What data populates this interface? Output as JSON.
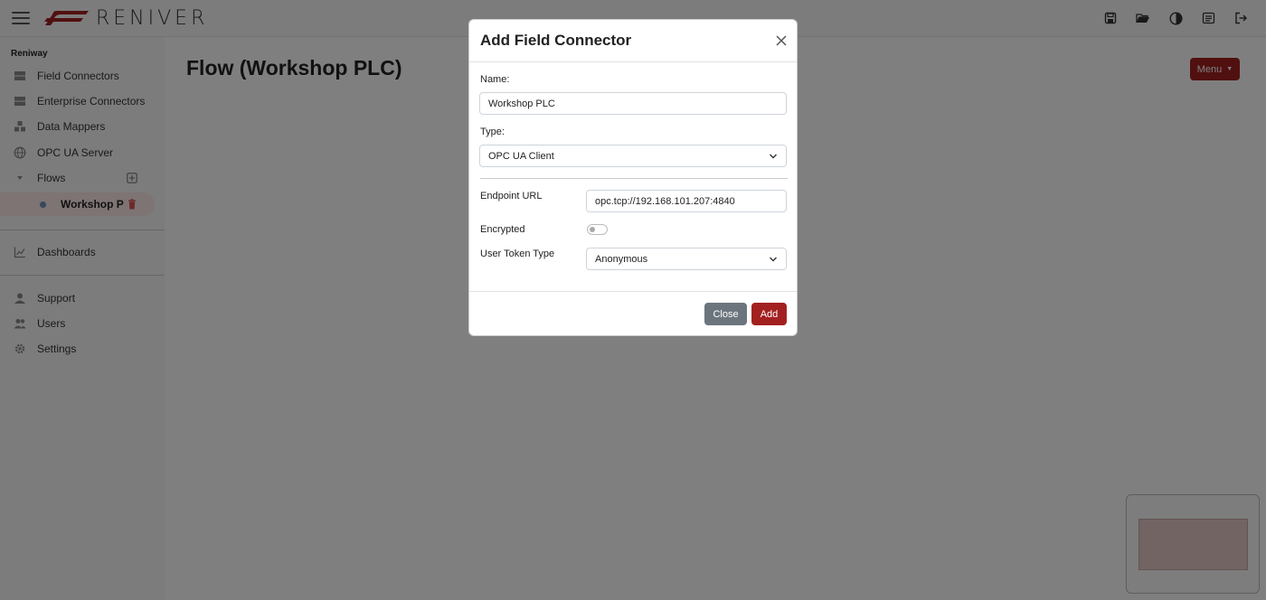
{
  "header": {
    "logo_text": "RENIVER",
    "icons": [
      "menu-icon",
      "save-icon",
      "folder-open-icon",
      "contrast-icon",
      "notes-icon",
      "logout-icon"
    ]
  },
  "sidebar": {
    "brand": "Reniway",
    "items": [
      {
        "label": "Field Connectors",
        "icon": "server-icon"
      },
      {
        "label": "Enterprise Connectors",
        "icon": "server-icon"
      },
      {
        "label": "Data Mappers",
        "icon": "cubes-icon"
      },
      {
        "label": "OPC UA Server",
        "icon": "globe-icon"
      },
      {
        "label": "Flows",
        "icon": "chevron-down-icon"
      }
    ],
    "active_flow": "Workshop PLC",
    "secondary": [
      {
        "label": "Dashboards",
        "icon": "chart-icon"
      }
    ],
    "bottom": [
      {
        "label": "Support",
        "icon": "support-icon"
      },
      {
        "label": "Users",
        "icon": "users-icon"
      },
      {
        "label": "Settings",
        "icon": "gear-icon"
      }
    ]
  },
  "main": {
    "title": "Flow (Workshop PLC)",
    "menu_label": "Menu"
  },
  "modal": {
    "title": "Add Field Connector",
    "name_label": "Name:",
    "name_value": "Workshop PLC",
    "type_label": "Type:",
    "type_value": "OPC UA Client",
    "endpoint_label": "Endpoint URL",
    "endpoint_value": "opc.tcp://192.168.101.207:4840",
    "encrypted_label": "Encrypted",
    "encrypted": false,
    "token_label": "User Token Type",
    "token_value": "Anonymous",
    "close_label": "Close",
    "add_label": "Add"
  },
  "colors": {
    "accent": "#a32020",
    "secondary_button": "#6c757d",
    "active_row": "#fbe9e7"
  }
}
